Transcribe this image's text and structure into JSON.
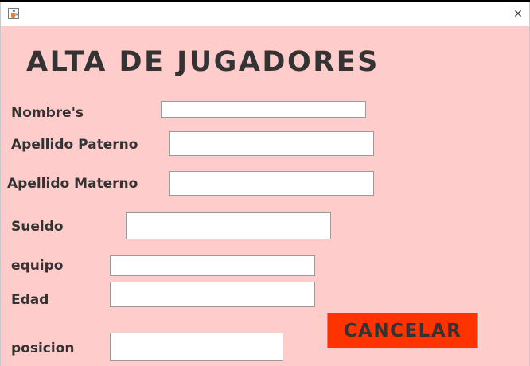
{
  "window": {
    "close_glyph": "✕",
    "app_icon": "java-cup-icon"
  },
  "form": {
    "title": "ALTA DE JUGADORES",
    "fields": {
      "nombres": {
        "label": "Nombre's",
        "value": ""
      },
      "apellido_paterno": {
        "label": "Apellido Paterno",
        "value": ""
      },
      "apellido_materno": {
        "label": "Apellido Materno",
        "value": ""
      },
      "sueldo": {
        "label": "Sueldo",
        "value": ""
      },
      "equipo": {
        "label": "equipo",
        "value": ""
      },
      "edad": {
        "label": "Edad",
        "value": ""
      },
      "posicion": {
        "label": "posicion",
        "value": ""
      }
    },
    "cancel_label": "CANCELAR"
  },
  "colors": {
    "background": "#ffcccc",
    "button": "#ff3300",
    "text": "#333333"
  }
}
